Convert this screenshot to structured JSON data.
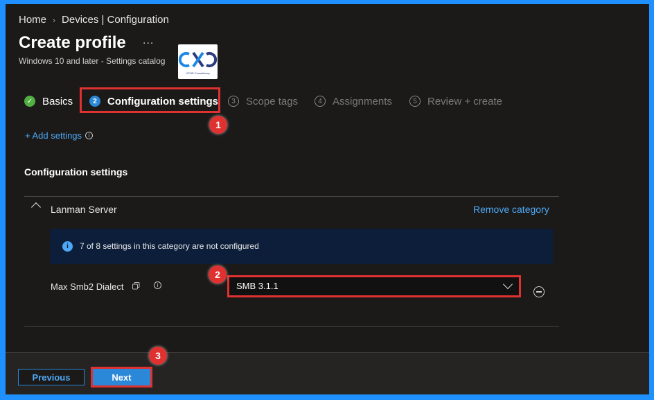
{
  "breadcrumb": [
    "Home",
    "Devices | Configuration"
  ],
  "page": {
    "title": "Create profile",
    "more_label": "...",
    "subtitle": "Windows 10 and later - Settings catalog",
    "logo_caption": "HTMD Consultancy"
  },
  "steps": [
    {
      "number": "✓",
      "label": "Basics",
      "state": "done"
    },
    {
      "number": "2",
      "label": "Configuration settings",
      "state": "current"
    },
    {
      "number": "3",
      "label": "Scope tags",
      "state": "pending"
    },
    {
      "number": "4",
      "label": "Assignments",
      "state": "pending"
    },
    {
      "number": "5",
      "label": "Review + create",
      "state": "pending"
    }
  ],
  "add_settings_label": "+ Add settings",
  "section_title": "Configuration settings",
  "category": {
    "name": "Lanman Server",
    "remove_label": "Remove category",
    "info_message": "7 of 8 settings in this category are not configured",
    "setting": {
      "label": "Max Smb2 Dialect",
      "selected_value": "SMB 3.1.1"
    }
  },
  "footer": {
    "previous_label": "Previous",
    "next_label": "Next"
  },
  "annotations": [
    "1",
    "2",
    "3"
  ],
  "colors": {
    "accent": "#2b88d8",
    "link": "#4ea8f5",
    "annotation_red": "#e03131",
    "done_green": "#52b043",
    "background": "#1b1a19",
    "page_border": "#1e90ff"
  }
}
